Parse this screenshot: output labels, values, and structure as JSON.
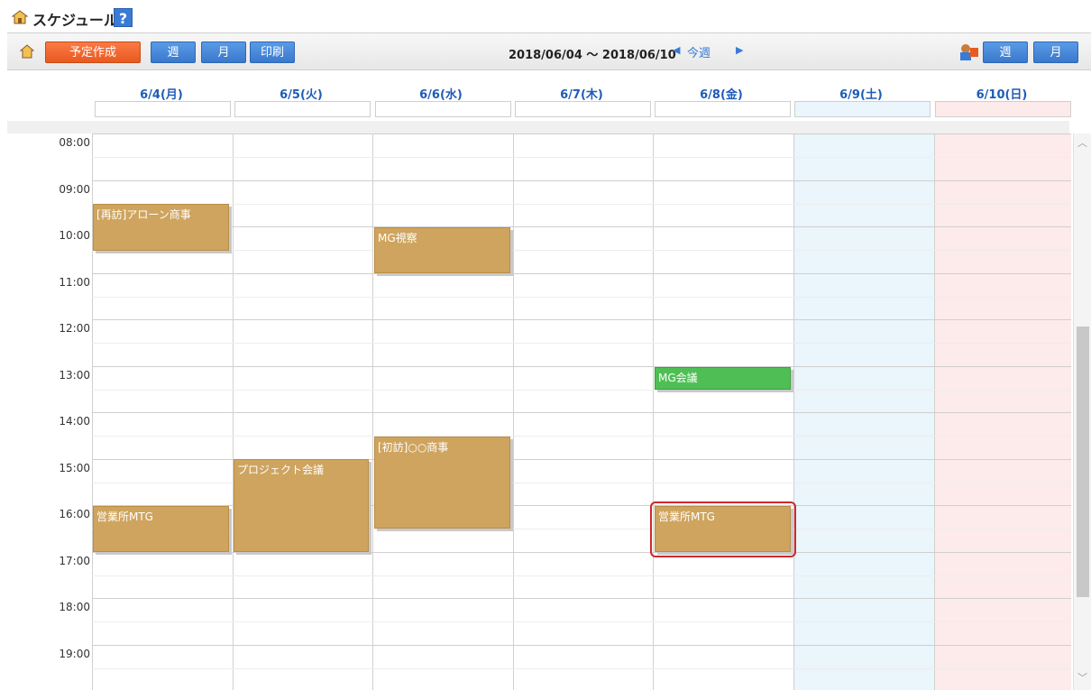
{
  "title": {
    "text": "スケジュール",
    "help_label": "?"
  },
  "toolbar": {
    "create_label": "予定作成",
    "week_label": "週",
    "month_label": "月",
    "print_label": "印刷",
    "date_range": "2018/06/04 〜 2018/06/10",
    "prev_arrow": "◀",
    "this_week_label": "今週",
    "next_arrow": "▶",
    "right_week_label": "週",
    "right_month_label": "月"
  },
  "days": [
    {
      "label": "6/4(月)"
    },
    {
      "label": "6/5(火)"
    },
    {
      "label": "6/6(水)"
    },
    {
      "label": "6/7(木)"
    },
    {
      "label": "6/8(金)"
    },
    {
      "label": "6/9(土)"
    },
    {
      "label": "6/10(日)"
    }
  ],
  "times": [
    "08:00",
    "09:00",
    "10:00",
    "11:00",
    "12:00",
    "13:00",
    "14:00",
    "15:00",
    "16:00",
    "17:00",
    "18:00",
    "19:00"
  ],
  "events": [
    {
      "title": "[再訪]アローン商事",
      "day": "6/4(月)",
      "start": "09:30",
      "end": "10:30"
    },
    {
      "title": "MG視察",
      "day": "6/6(水)",
      "start": "10:00",
      "end": "11:00"
    },
    {
      "title": "MG会議",
      "day": "6/8(金)",
      "start": "13:00",
      "end": "13:30"
    },
    {
      "title": "[初訪]○○商事",
      "day": "6/6(水)",
      "start": "14:30",
      "end": "16:30"
    },
    {
      "title": "プロジェクト会議",
      "day": "6/5(火)",
      "start": "15:00",
      "end": "17:00"
    },
    {
      "title": "営業所MTG",
      "day": "6/4(月)",
      "start": "16:00",
      "end": "17:00"
    },
    {
      "title": "営業所MTG",
      "day": "6/8(金)",
      "start": "16:00",
      "end": "17:00"
    }
  ],
  "colors": {
    "event": "#cfa45e",
    "event_green": "#4fbf55",
    "saturday_bg": "#eaf5fc",
    "sunday_bg": "#fdeaea",
    "day_text": "#1e5bb8",
    "highlight": "#d0282b"
  },
  "scroll": {
    "up": "︿",
    "down": "﹀"
  },
  "icons": {
    "title_icon": "schedule-app-icon",
    "toolbar_icon": "home-icon",
    "right_icon": "user-calendar-icon"
  }
}
